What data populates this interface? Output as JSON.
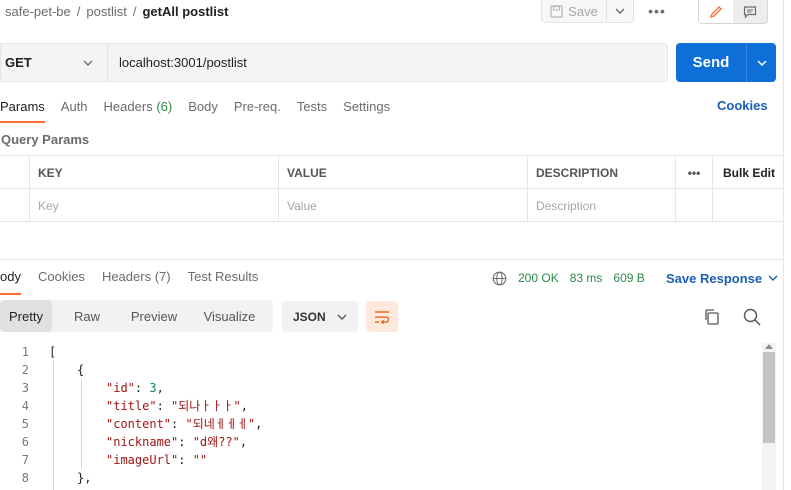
{
  "breadcrumb": {
    "collection": "safe-pet-be",
    "folder": "postlist",
    "request": "getAll postlist",
    "separator": "/"
  },
  "toolbar": {
    "save_label": "Save",
    "more_label": "•••"
  },
  "request": {
    "method": "GET",
    "url": "localhost:3001/postlist",
    "send_label": "Send"
  },
  "request_tabs": {
    "params": "Params",
    "auth": "Auth",
    "headers": "Headers",
    "headers_count": "(6)",
    "body": "Body",
    "prereq": "Pre-req.",
    "tests": "Tests",
    "settings": "Settings",
    "cookies": "Cookies"
  },
  "query_params": {
    "title": "Query Params",
    "columns": {
      "key": "KEY",
      "value": "VALUE",
      "description": "DESCRIPTION",
      "more": "•••",
      "bulk_edit": "Bulk Edit"
    },
    "placeholders": {
      "key": "Key",
      "value": "Value",
      "description": "Description"
    }
  },
  "response_tabs": {
    "body": "ody",
    "cookies": "Cookies",
    "headers": "Headers",
    "headers_count": "(7)",
    "test_results": "Test Results"
  },
  "response_status": {
    "status": "200 OK",
    "time": "83 ms",
    "size": "609 B",
    "save_response": "Save Response",
    "color_ok": "#2c8a4a"
  },
  "body_view": {
    "pretty": "Pretty",
    "raw": "Raw",
    "preview": "Preview",
    "visualize": "Visualize",
    "format": "JSON"
  },
  "code_lines": [
    {
      "n": "1",
      "text": "["
    },
    {
      "n": "2",
      "text": "{"
    },
    {
      "n": "3",
      "key": "\"id\"",
      "sep": ": ",
      "num": "3",
      "end": ","
    },
    {
      "n": "4",
      "key": "\"title\"",
      "sep": ": ",
      "str": "\"되나ㅏㅏㅏ\"",
      "end": ","
    },
    {
      "n": "5",
      "key": "\"content\"",
      "sep": ": ",
      "str": "\"되네ㅔㅔㅔ\"",
      "end": ","
    },
    {
      "n": "6",
      "key": "\"nickname\"",
      "sep": ": ",
      "str": "\"d왜??\"",
      "end": ","
    },
    {
      "n": "7",
      "key": "\"imageUrl\"",
      "sep": ": ",
      "str": "\"\"",
      "end": ""
    },
    {
      "n": "8",
      "text": "},"
    }
  ],
  "colors": {
    "accent": "#ff6c37",
    "send": "#0f6fd9",
    "link": "#1a5fb4"
  }
}
